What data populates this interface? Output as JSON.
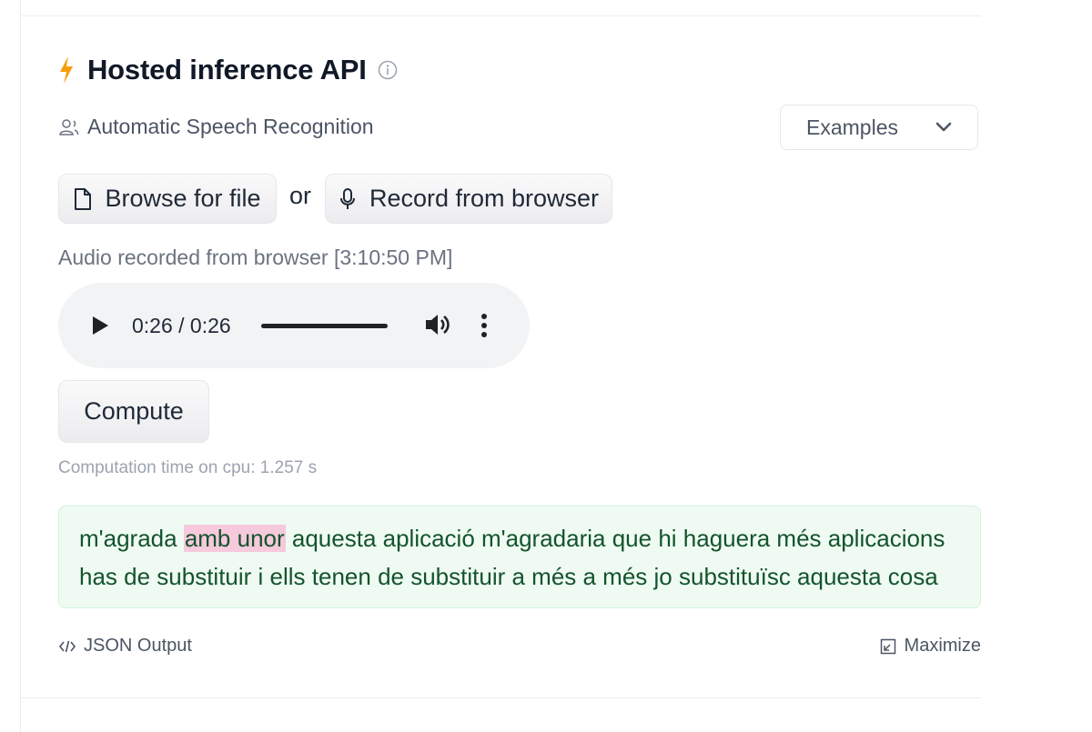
{
  "widget": {
    "title": "Hosted inference API",
    "icons": {
      "title": "bolt-icon",
      "info": "info-icon"
    }
  },
  "task": {
    "label": "Automatic Speech Recognition",
    "icon": "task-user-icon"
  },
  "examples": {
    "label": "Examples",
    "icon": "chevron-down-icon"
  },
  "actions": {
    "browse_label": "Browse for file",
    "or_label": "or",
    "record_label": "Record from browser"
  },
  "audio": {
    "source_label": "Audio recorded from browser [3:10:50 PM]",
    "time_display": "0:26 / 0:26",
    "progress_fraction": 1.0
  },
  "compute": {
    "button_label": "Compute",
    "time_label": "Computation time on cpu: 1.257 s"
  },
  "output": {
    "segments": [
      {
        "text": "m'agrada ",
        "highlight": false
      },
      {
        "text": "amb unor",
        "highlight": true
      },
      {
        "text": " aquesta aplicació m'agradaria que hi haguera més aplicacions has de substituir i ells tenen de substituir a més a més jo substituïsc aquesta cosa",
        "highlight": false
      }
    ]
  },
  "footer": {
    "json_label": "JSON Output",
    "maximize_label": "Maximize"
  },
  "colors": {
    "accent_bolt": "#f59e0b",
    "output_bg": "#effbf2",
    "output_text": "#14532d",
    "highlight": "#f6c9dc"
  }
}
